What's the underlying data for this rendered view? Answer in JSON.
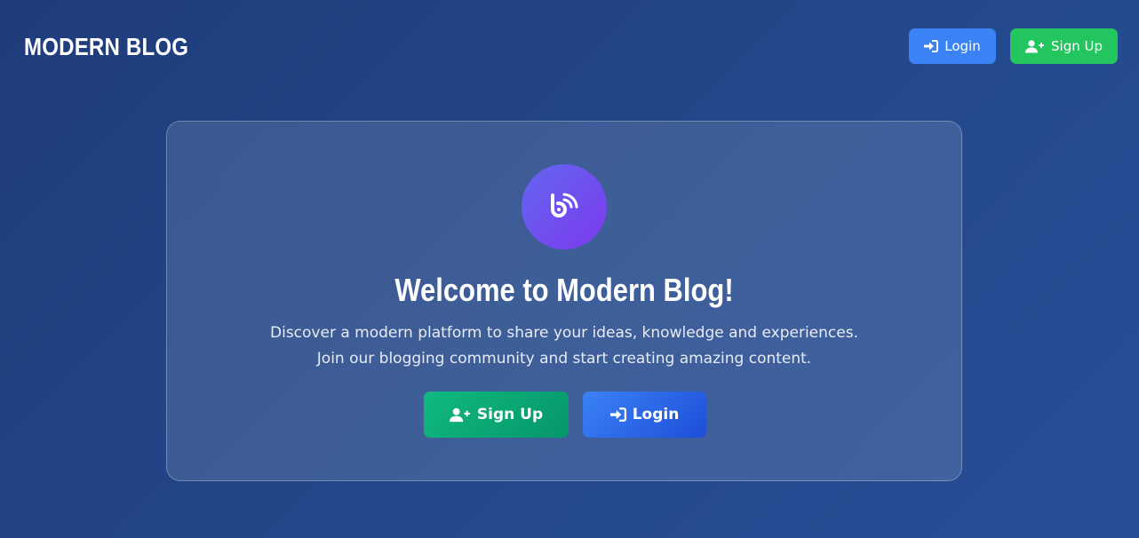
{
  "header": {
    "brand": "MODERN BLOG",
    "login_label": "Login",
    "signup_label": "Sign Up"
  },
  "hero": {
    "icon": "blog-icon",
    "title": "Welcome to Modern Blog!",
    "description_line1": "Discover a modern platform to share your ideas, knowledge and experiences.",
    "description_line2": "Join our blogging community and start creating amazing content.",
    "signup_label": "Sign Up",
    "login_label": "Login"
  },
  "colors": {
    "login_blue": "#3b82f6",
    "signup_green": "#22c55e",
    "logo_purple": "#7c3aed"
  }
}
